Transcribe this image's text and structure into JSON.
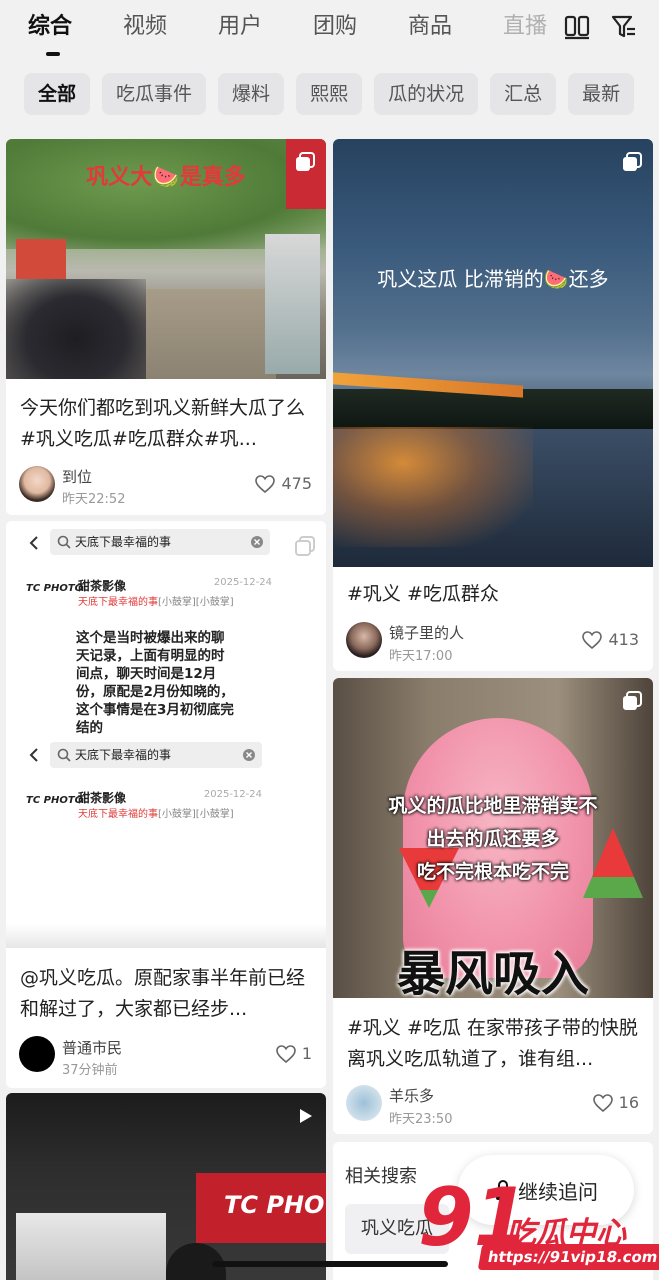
{
  "tabs": [
    {
      "label": "综合"
    },
    {
      "label": "视频"
    },
    {
      "label": "用户"
    },
    {
      "label": "团购"
    },
    {
      "label": "商品"
    },
    {
      "label": "直播"
    }
  ],
  "filters": [
    {
      "label": "全部"
    },
    {
      "label": "吃瓜事件"
    },
    {
      "label": "爆料"
    },
    {
      "label": "熙熙"
    },
    {
      "label": "瓜的状况"
    },
    {
      "label": "汇总"
    },
    {
      "label": "最新"
    }
  ],
  "cards": {
    "c1": {
      "overlay": "巩义大🍉是真多",
      "title": "今天你们都吃到巩义新鲜大瓜了么#巩义吃瓜#吃瓜群众#巩...",
      "author": "到位",
      "time": "昨天22:52",
      "likes": "475"
    },
    "c2": {
      "search_text": "天底下最幸福的事",
      "source_name": "甜茶影像",
      "source_logo": "TC PHOTO",
      "date": "2025-12-24",
      "sub_red": "天底下最幸福的事",
      "sub_grey": "[小鼓掌][小鼓掌]",
      "body": "这个是当时被爆出来的聊天记录，上面有明显的时间点，聊天时间是12月份，原配是2月份知晓的，这个事情是在3月初彻底完结的",
      "search_text2": "天底下最幸福的事",
      "source_name2": "甜茶影像",
      "date2": "2025-12-24",
      "title": "@巩义吃瓜。原配家事半年前已经和解过了，大家都已经步...",
      "author": "普通市民",
      "time": "37分钟前",
      "likes": "1"
    },
    "c3": {
      "overlay": "巩义这瓜 比滞销的🍉还多",
      "title": "#巩义 #吃瓜群众",
      "author": "镜子里的人",
      "time": "昨天17:00",
      "likes": "413"
    },
    "c4": {
      "overlay_lines": [
        "巩义的瓜比地里滞销卖不",
        "出去的瓜还要多",
        "吃不完根本吃不完"
      ],
      "big_text": "暴风吸入",
      "title": "#巩义 #吃瓜 在家带孩子带的快脱离巩义吃瓜轨道了，谁有组...",
      "author": "羊乐多",
      "time": "昨天23:50",
      "likes": "16"
    },
    "c5": {
      "sign_text": "TC PHO"
    }
  },
  "related": {
    "title": "相关搜索",
    "chip": "巩义吃瓜"
  },
  "followup": {
    "label": "继续追问"
  },
  "watermark": {
    "number": "91",
    "brand": "吃瓜中心",
    "url": "https://91vip18.com"
  },
  "icons": {
    "layout": "layout-grid-icon",
    "filter": "filter-icon",
    "multi": "multi-image-icon",
    "heart": "heart-icon",
    "play": "play-icon",
    "back": "chevron-left-icon",
    "search": "search-icon",
    "clear": "clear-icon"
  }
}
